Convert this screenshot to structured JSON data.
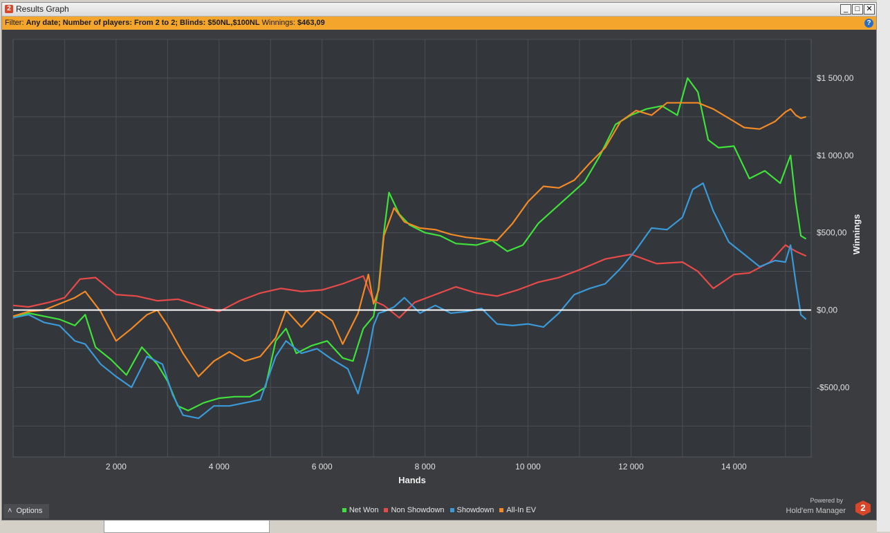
{
  "window": {
    "title": "Results Graph",
    "app_icon": "2",
    "buttons": {
      "minimize": "_",
      "maximize": "□",
      "close": "✕"
    }
  },
  "filter": {
    "label": "Filter:",
    "text": "Any date; Number of players: From 2 to 2; Blinds: $50NL,$100NL",
    "winnings_label": "Winnings:",
    "winnings_value": "$463,09",
    "help_icon": "?"
  },
  "options_label": "Options",
  "options_icon": "˄",
  "powered_by": "Powered by",
  "brand": "Hold'em Manager",
  "brand_logo": "2",
  "colors": {
    "background": "#3a3c3f",
    "grid": "#4c4f53",
    "zero_line": "#ffffff",
    "filter_bar": "#f4a62c"
  },
  "chart_data": {
    "type": "line",
    "xlabel": "Hands",
    "ylabel": "Winnings",
    "xlim": [
      0,
      15500
    ],
    "ylim": [
      -950,
      1750
    ],
    "x_ticks": [
      2000,
      4000,
      6000,
      8000,
      10000,
      12000,
      14000
    ],
    "x_tick_labels": [
      "2 000",
      "4 000",
      "6 000",
      "8 000",
      "10 000",
      "12 000",
      "14 000"
    ],
    "y_ticks": [
      -500,
      0,
      500,
      1000,
      1500
    ],
    "y_tick_labels": [
      "-$500,00",
      "$0,00",
      "$500,00",
      "$1 000,00",
      "$1 500,00"
    ],
    "grid": true,
    "legend_position": "bottom",
    "series": [
      {
        "name": "Net Won",
        "color": "#3fe23a",
        "x": [
          0,
          300,
          600,
          900,
          1200,
          1400,
          1600,
          1900,
          2200,
          2500,
          2800,
          3000,
          3200,
          3400,
          3700,
          4000,
          4300,
          4600,
          4900,
          5100,
          5300,
          5500,
          5800,
          6100,
          6400,
          6600,
          6800,
          7000,
          7100,
          7200,
          7300,
          7500,
          7700,
          8000,
          8300,
          8600,
          9000,
          9300,
          9600,
          9900,
          10200,
          10500,
          10800,
          11100,
          11400,
          11700,
          12000,
          12300,
          12600,
          12900,
          13100,
          13300,
          13500,
          13700,
          14000,
          14300,
          14600,
          14900,
          15100,
          15200,
          15300,
          15400
        ],
        "y": [
          -50,
          -20,
          -40,
          -60,
          -100,
          -30,
          -240,
          -320,
          -420,
          -240,
          -350,
          -460,
          -620,
          -650,
          -600,
          -570,
          -560,
          -560,
          -500,
          -200,
          -120,
          -280,
          -230,
          -200,
          -310,
          -330,
          -120,
          -40,
          150,
          500,
          760,
          620,
          550,
          500,
          480,
          430,
          420,
          450,
          380,
          420,
          560,
          650,
          740,
          830,
          1000,
          1200,
          1260,
          1300,
          1320,
          1260,
          1500,
          1410,
          1100,
          1050,
          1060,
          850,
          900,
          820,
          1000,
          700,
          480,
          460
        ]
      },
      {
        "name": "Non Showdown",
        "color": "#e84a4a",
        "x": [
          0,
          300,
          700,
          1000,
          1300,
          1600,
          2000,
          2400,
          2800,
          3200,
          3600,
          4000,
          4400,
          4800,
          5200,
          5600,
          6000,
          6400,
          6800,
          7000,
          7200,
          7500,
          7800,
          8200,
          8600,
          9000,
          9400,
          9800,
          10200,
          10600,
          11000,
          11500,
          12000,
          12500,
          13000,
          13300,
          13600,
          14000,
          14300,
          14700,
          15000,
          15200,
          15400
        ],
        "y": [
          30,
          20,
          50,
          80,
          200,
          210,
          100,
          90,
          60,
          70,
          30,
          -10,
          60,
          110,
          140,
          120,
          130,
          170,
          220,
          60,
          30,
          -50,
          50,
          100,
          150,
          110,
          90,
          130,
          180,
          210,
          260,
          330,
          360,
          300,
          310,
          250,
          140,
          230,
          240,
          310,
          420,
          380,
          350
        ]
      },
      {
        "name": "Showdown",
        "color": "#3a9ad9",
        "x": [
          0,
          300,
          600,
          900,
          1200,
          1400,
          1700,
          2000,
          2300,
          2600,
          2900,
          3100,
          3300,
          3600,
          3900,
          4200,
          4500,
          4800,
          5100,
          5300,
          5600,
          5900,
          6200,
          6500,
          6700,
          6900,
          7000,
          7100,
          7200,
          7400,
          7600,
          7900,
          8200,
          8500,
          8800,
          9100,
          9400,
          9700,
          10000,
          10300,
          10600,
          10900,
          11200,
          11500,
          11800,
          12100,
          12400,
          12700,
          13000,
          13200,
          13400,
          13600,
          13900,
          14200,
          14500,
          14800,
          15000,
          15100,
          15200,
          15300,
          15400
        ],
        "y": [
          -50,
          -30,
          -80,
          -100,
          -200,
          -220,
          -350,
          -430,
          -500,
          -300,
          -350,
          -550,
          -680,
          -700,
          -620,
          -620,
          -600,
          -580,
          -300,
          -200,
          -280,
          -250,
          -320,
          -380,
          -540,
          -280,
          -100,
          -20,
          -10,
          20,
          80,
          -20,
          30,
          -20,
          -10,
          10,
          -90,
          -100,
          -90,
          -110,
          -20,
          100,
          140,
          170,
          270,
          390,
          530,
          520,
          600,
          780,
          820,
          640,
          440,
          360,
          280,
          320,
          310,
          420,
          180,
          -30,
          -60
        ]
      },
      {
        "name": "All-In EV",
        "color": "#f28a25",
        "x": [
          0,
          300,
          600,
          900,
          1200,
          1400,
          1700,
          2000,
          2300,
          2600,
          2800,
          3000,
          3300,
          3600,
          3900,
          4200,
          4500,
          4800,
          5100,
          5300,
          5600,
          5900,
          6200,
          6400,
          6700,
          6900,
          7000,
          7100,
          7200,
          7400,
          7600,
          7900,
          8200,
          8500,
          8800,
          9100,
          9400,
          9700,
          10000,
          10300,
          10600,
          10900,
          11200,
          11500,
          11800,
          12100,
          12400,
          12700,
          13000,
          13300,
          13600,
          13900,
          14200,
          14500,
          14800,
          15000,
          15100,
          15200,
          15300,
          15400
        ],
        "y": [
          -40,
          -10,
          0,
          40,
          80,
          120,
          -10,
          -200,
          -120,
          -30,
          0,
          -100,
          -280,
          -430,
          -330,
          -270,
          -330,
          -300,
          -180,
          0,
          -110,
          0,
          -70,
          -220,
          -20,
          230,
          40,
          130,
          480,
          660,
          570,
          530,
          520,
          490,
          470,
          460,
          450,
          560,
          700,
          800,
          790,
          840,
          950,
          1050,
          1220,
          1290,
          1260,
          1340,
          1340,
          1340,
          1300,
          1240,
          1180,
          1170,
          1220,
          1280,
          1300,
          1260,
          1240,
          1250
        ]
      }
    ]
  }
}
